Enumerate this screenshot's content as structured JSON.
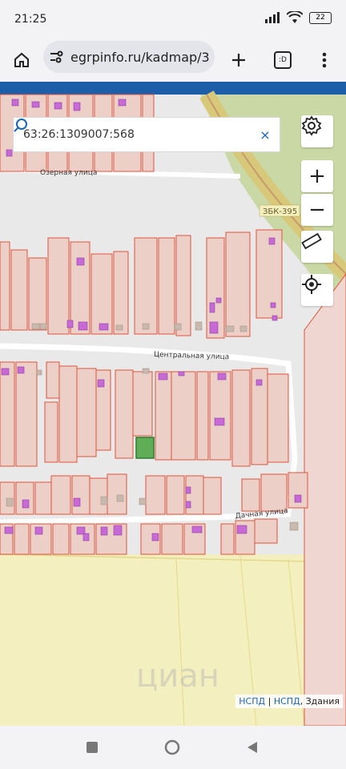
{
  "status": {
    "time": "21:25",
    "battery": "22"
  },
  "browser": {
    "url": "egrpinfo.ru/kadmap/3",
    "tab_icon": ":D"
  },
  "search": {
    "query": "63:26:1309007:568"
  },
  "map": {
    "streets": [
      "Озерная улица",
      "Центральная улица",
      "Дачная улица"
    ],
    "road_label": "ЗБК-395",
    "attribution": {
      "link1": "НСПД",
      "sep": " | ",
      "link2": "НСПД",
      "tail": ", Здания"
    },
    "watermark": "циан"
  },
  "colors": {
    "parcel_stroke": "#e0533c",
    "parcel_fill": "#ecd0c8",
    "building": "#c76ad6",
    "selected": "#5fad56",
    "field": "#f4efbe",
    "forest": "#c9d8a4",
    "accent": "#1a66b6"
  }
}
